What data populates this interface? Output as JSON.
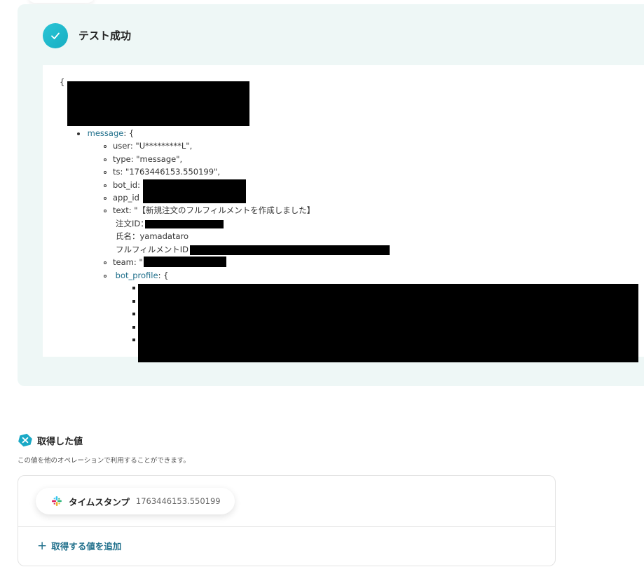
{
  "result": {
    "title": "テスト成功"
  },
  "json_view": {
    "open_brace": "{",
    "message_key": "message",
    "message_suffix": ": {",
    "lines": {
      "user": "user: \"U*********L\",",
      "type": "type: \"message\",",
      "ts": "ts: \"1763446153.550199\",",
      "bot_id": "bot_id:",
      "app_id": "app_id",
      "text_line1": "text: \"【新規注文のフルフィルメントを作成しました】",
      "text_line2": "注文ID：",
      "text_line3": "氏名：yamadataro",
      "text_line4": "フルフィルメントID：",
      "team": "team: \""
    },
    "bot_profile_key": "bot_profile",
    "bot_profile_suffix": ": {"
  },
  "acquired_values": {
    "title": "取得した値",
    "description": "この値を他のオペレーションで利用することができます。",
    "items": [
      {
        "label": "タイムスタンプ",
        "value": "1763446153.550199",
        "icon": "slack-icon"
      }
    ],
    "add_label": "取得する値を追加"
  },
  "colors": {
    "panel_bg": "#eef7f6",
    "accent_teal": "#1f6f8b",
    "check_cyan": "#29c5d6"
  }
}
